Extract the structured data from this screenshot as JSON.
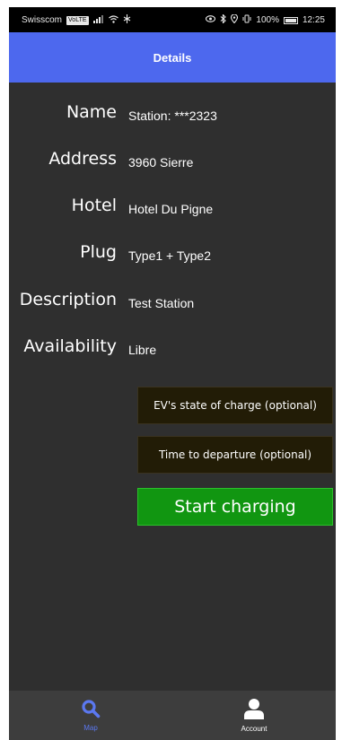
{
  "status_bar": {
    "carrier": "Swisscom",
    "carrier_badge": "VoLTE",
    "battery": "100%",
    "time": "12:25"
  },
  "header": {
    "title": "Details"
  },
  "details": [
    {
      "label": "Name",
      "value": "Station: ***2323"
    },
    {
      "label": "Address",
      "value": "3960 Sierre"
    },
    {
      "label": "Hotel",
      "value": "Hotel Du Pigne"
    },
    {
      "label": "Plug",
      "value": "Type1 + Type2"
    },
    {
      "label": "Description",
      "value": "Test Station"
    },
    {
      "label": "Availability",
      "value": "Libre"
    }
  ],
  "inputs": {
    "soc_label": "EV's state of charge (optional)",
    "departure_label": "Time to departure (optional)"
  },
  "actions": {
    "start_label": "Start charging"
  },
  "bottom_nav": {
    "map_label": "Map",
    "account_label": "Account",
    "map_icon": "search-icon",
    "account_icon": "user-icon"
  },
  "colors": {
    "header_bg": "#4d68ee",
    "page_bg": "#2f2f2f",
    "input_bg": "#221c06",
    "button_bg": "#119611",
    "nav_active": "#5b78f0",
    "nav_inactive": "#ffffff"
  }
}
